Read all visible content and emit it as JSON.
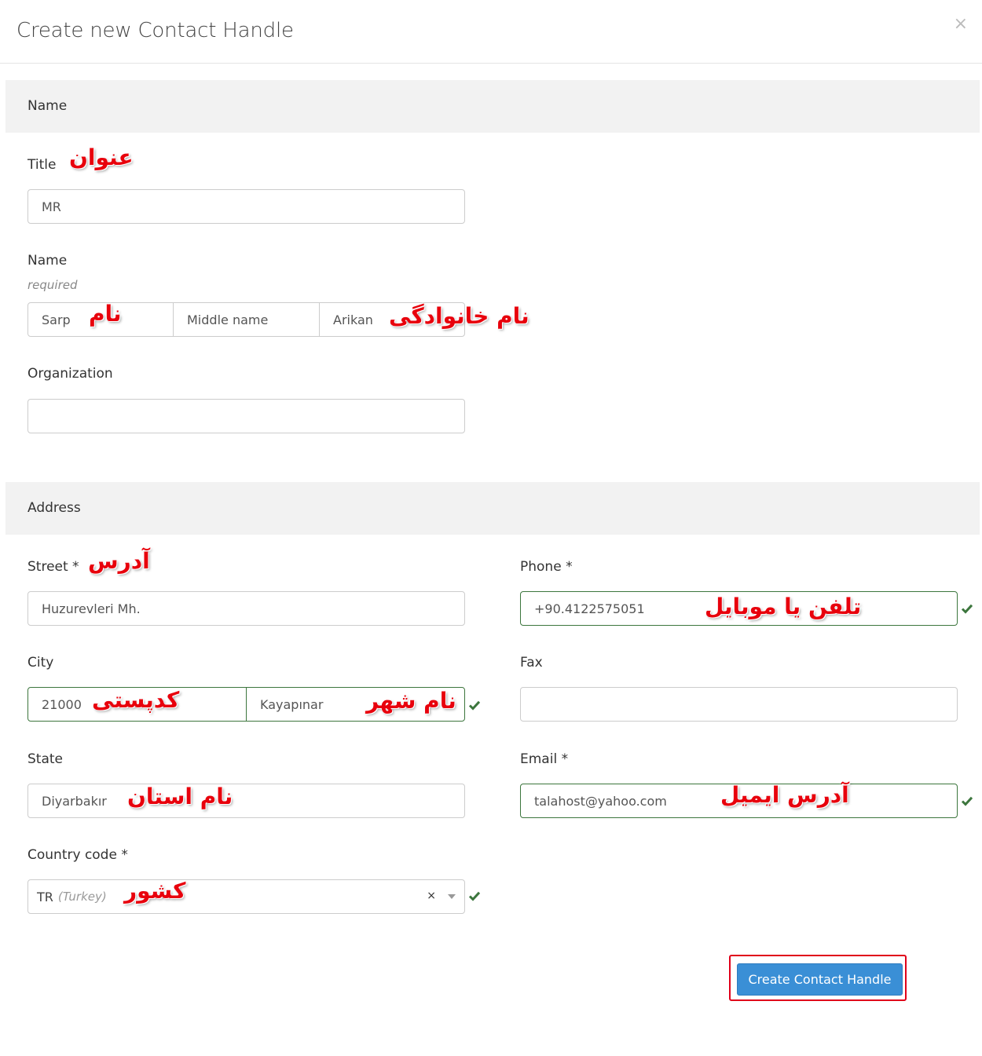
{
  "header": {
    "title": "Create new Contact Handle",
    "close": "×"
  },
  "sections": {
    "name": "Name",
    "address": "Address"
  },
  "title_field": {
    "label": "Title",
    "value": "MR",
    "annotation": "عنوان"
  },
  "name_field": {
    "label": "Name",
    "help": "required",
    "first": "Sarp",
    "middle_placeholder": "Middle name",
    "last": "Arikan",
    "annotation_first": "نام",
    "annotation_last": "نام خانوادگی"
  },
  "organization_field": {
    "label": "Organization",
    "value": ""
  },
  "street_field": {
    "label": "Street *",
    "value": "Huzurevleri Mh.",
    "annotation": "آدرس"
  },
  "phone_field": {
    "label": "Phone *",
    "value": "+90.4122575051",
    "annotation": "تلفن یا موبایل"
  },
  "city_field": {
    "label": "City",
    "postal": "21000",
    "city": "Kayapınar",
    "annotation_postal": "کدپستی",
    "annotation_city": "نام شهر"
  },
  "fax_field": {
    "label": "Fax",
    "value": ""
  },
  "state_field": {
    "label": "State",
    "value": "Diyarbakır",
    "annotation": "نام استان"
  },
  "email_field": {
    "label": "Email *",
    "value": "talahost@yahoo.com",
    "annotation": "آدرس ایمیل"
  },
  "country_field": {
    "label": "Country code *",
    "code": "TR",
    "country": "(Turkey)",
    "clear": "×",
    "annotation": "کشور"
  },
  "submit": {
    "label": "Create Contact Handle"
  },
  "colors": {
    "valid": "#3c763d",
    "primary": "#3a8fd6",
    "annotation": "#e8000c"
  }
}
